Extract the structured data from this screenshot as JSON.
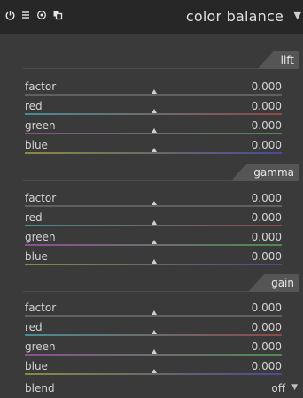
{
  "header": {
    "title": "color balance",
    "icons": [
      "power-icon",
      "presets-menu-icon",
      "reset-icon",
      "duplicate-icon"
    ],
    "expand_icon": "chevron-down-icon"
  },
  "sections": [
    {
      "name": "lift",
      "sliders": [
        {
          "label": "factor",
          "value": "0.000",
          "track_color": "#606060"
        },
        {
          "label": "red",
          "value": "0.000",
          "track_color": "#5a8a8c"
        },
        {
          "label": "green",
          "value": "0.000",
          "track_color": "#8a5a90"
        },
        {
          "label": "blue",
          "value": "0.000",
          "track_color": "#8a8a46"
        }
      ]
    },
    {
      "name": "gamma",
      "sliders": [
        {
          "label": "factor",
          "value": "0.000",
          "track_color": "#606060"
        },
        {
          "label": "red",
          "value": "0.000",
          "track_color": "#5a8a8c"
        },
        {
          "label": "green",
          "value": "0.000",
          "track_color": "#8a5a90"
        },
        {
          "label": "blue",
          "value": "0.000",
          "track_color": "#8a8a46"
        }
      ]
    },
    {
      "name": "gain",
      "sliders": [
        {
          "label": "factor",
          "value": "0.000",
          "track_color": "#606060"
        },
        {
          "label": "red",
          "value": "0.000",
          "track_color": "#5a8a8c"
        },
        {
          "label": "green",
          "value": "0.000",
          "track_color": "#8a5a90"
        },
        {
          "label": "blue",
          "value": "0.000",
          "track_color": "#8a8a46"
        }
      ]
    }
  ],
  "blend": {
    "label": "blend",
    "value": "off"
  },
  "colors": {
    "panel_bg": "#3a3a3a",
    "header_bg": "#272727",
    "tab_bg": "#555555",
    "text": "#d4d4d4"
  }
}
